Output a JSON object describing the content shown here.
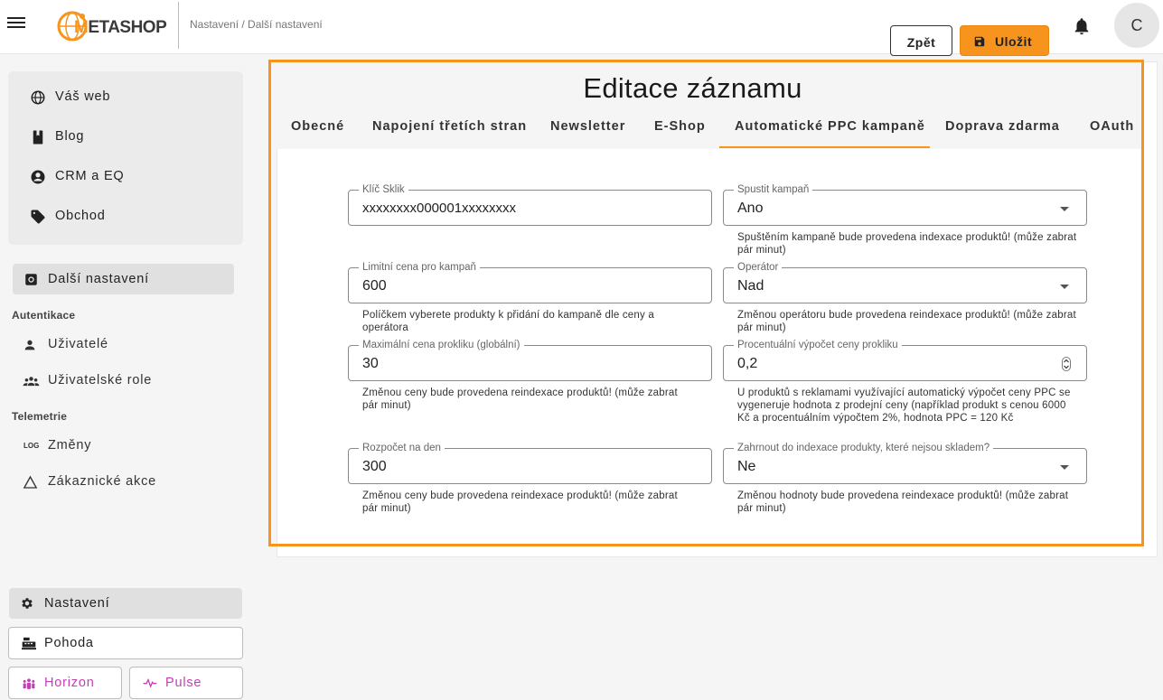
{
  "header": {
    "logo_text_main": "METASHOP",
    "breadcrumb": "Nastavení / Další nastavení",
    "back_label": "Zpět",
    "save_label": "Uložit",
    "avatar_initial": "C"
  },
  "sidebar": {
    "card_items": [
      {
        "label": "Váš web",
        "icon": "globe-icon"
      },
      {
        "label": "Blog",
        "icon": "bookmark-icon"
      },
      {
        "label": "CRM a EQ",
        "icon": "account-circle-icon"
      },
      {
        "label": "Obchod",
        "icon": "tag-icon"
      }
    ],
    "active_item": "Další nastavení",
    "section_auth": "Autentikace",
    "users": "Uživatelé",
    "user_roles": "Uživatelské role",
    "section_telemetry": "Telemetrie",
    "log_badge": "LOG",
    "changes": "Změny",
    "customer_actions": "Zákaznické akce",
    "settings": "Nastavení",
    "pohoda": "Pohoda",
    "horizon": "Horizon",
    "pulse": "Pulse"
  },
  "panel": {
    "title": "Editace záznamu",
    "tabs": [
      "Obecné",
      "Napojení třetích stran",
      "Newsletter",
      "E-Shop",
      "Automatické PPC kampaně",
      "Doprava zdarma",
      "OAuth"
    ],
    "fields": {
      "sklik_key": {
        "label": "Klíč Sklik",
        "value": "xxxxxxxx000001xxxxxxxx"
      },
      "start_campaign": {
        "label": "Spustit kampaň",
        "value": "Ano",
        "help": "Spuštěním kampaně bude provedena indexace produktů! (může zabrat pár minut)"
      },
      "limit_price": {
        "label": "Limitní cena pro kampaň",
        "value": "600",
        "help": "Políčkem vyberete produkty k přidání do kampaně dle ceny a operátora"
      },
      "operator": {
        "label": "Operátor",
        "value": "Nad",
        "help": "Změnou operátoru bude provedena reindexace produktů! (může zabrat pár minut)"
      },
      "max_click_price": {
        "label": "Maximální cena prokliku (globální)",
        "value": "30",
        "help": "Změnou ceny bude provedena reindexace produktů! (může zabrat pár minut)"
      },
      "percent_click_price": {
        "label": "Procentuální výpočet ceny prokliku",
        "value": "0,2",
        "help": "U produktů s reklamami využívající automatický výpočet ceny PPC se vygeneruje hodnota z prodejní ceny (například produkt s cenou 6000 Kč a procentuálním výpočtem 2%, hodnota PPC = 120 Kč"
      },
      "daily_budget": {
        "label": "Rozpočet na den",
        "value": "300",
        "help": "Změnou ceny bude provedena reindexace produktů! (může zabrat pár minut)"
      },
      "include_out_of_stock": {
        "label": "Zahrnout do indexace produkty, které nejsou skladem?",
        "value": "Ne",
        "help": "Změnou hodnoty bude provedena reindexace produktů! (může zabrat pár minut)"
      }
    }
  },
  "colors": {
    "accent": "#f7941d",
    "horizon": "#c43fb7"
  }
}
